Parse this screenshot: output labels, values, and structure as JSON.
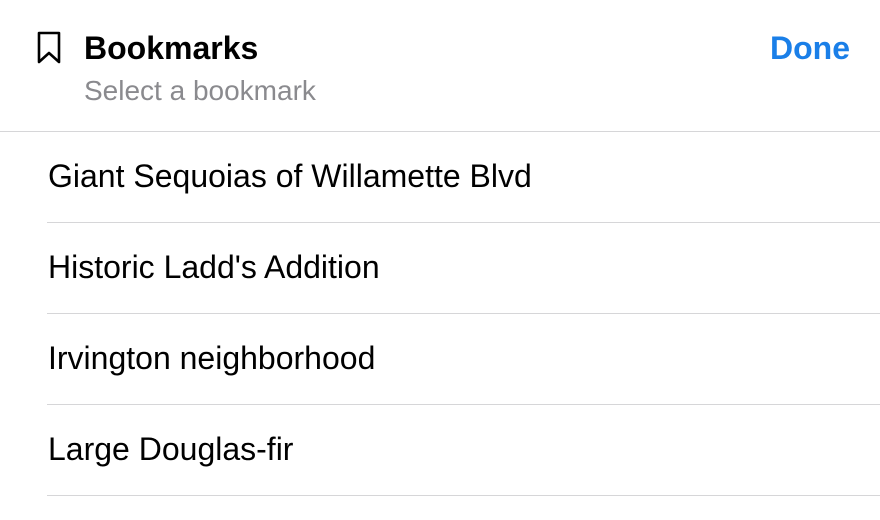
{
  "header": {
    "icon": "bookmark-icon",
    "title": "Bookmarks",
    "subtitle": "Select a bookmark",
    "done_label": "Done",
    "accent_color": "#1a7fe8"
  },
  "bookmarks": [
    {
      "label": "Giant Sequoias of Willamette Blvd"
    },
    {
      "label": "Historic Ladd's Addition"
    },
    {
      "label": "Irvington neighborhood"
    },
    {
      "label": "Large Douglas-fir"
    }
  ]
}
